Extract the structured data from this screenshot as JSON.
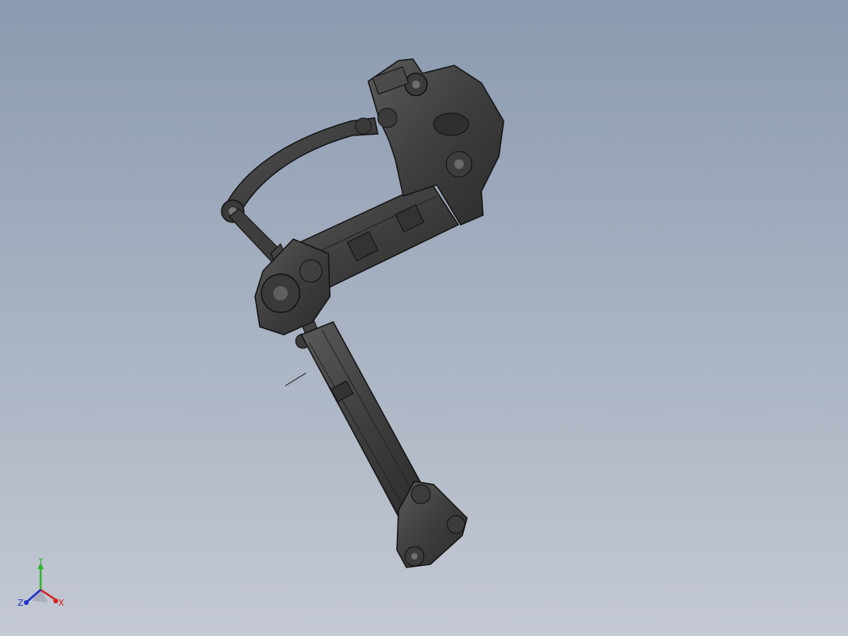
{
  "viewport": {
    "background_top": "#8b9ab0",
    "background_bottom": "#c4c9d3",
    "model_color": "#474747",
    "edge_color": "#1a1a1a"
  },
  "triad": {
    "x_label": "X",
    "y_label": "Y",
    "z_label": "Z",
    "x_color": "#d42020",
    "y_color": "#2fb52f",
    "z_color": "#2030c8"
  }
}
